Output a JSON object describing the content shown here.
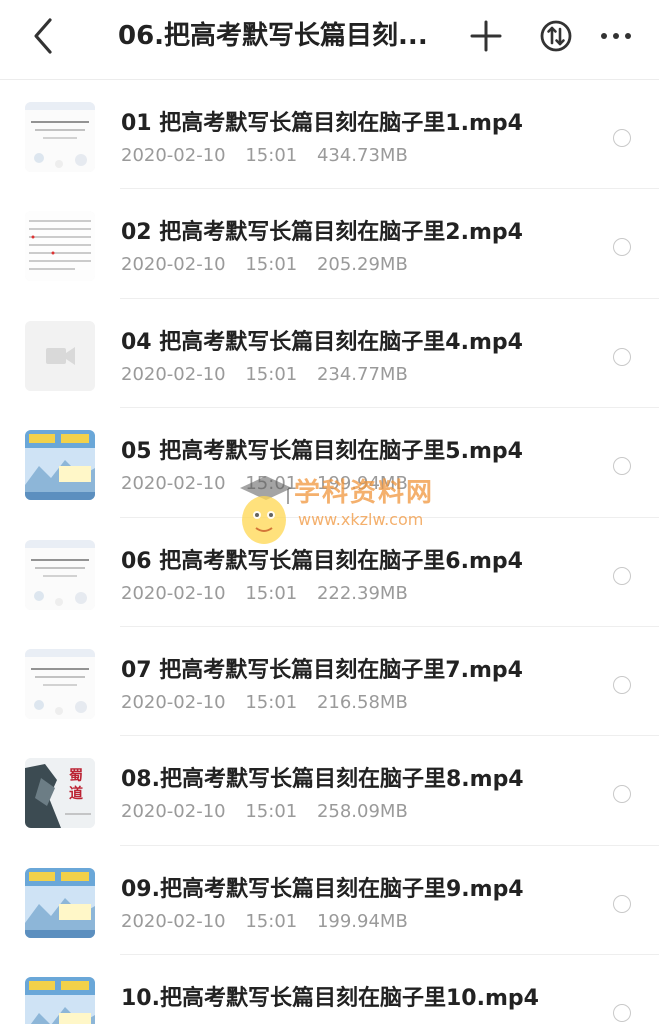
{
  "header": {
    "title": "06.把高考默写长篇目刻...",
    "back_icon": "chevron-left-icon",
    "add_icon": "plus-icon",
    "sort_icon": "sort-icon",
    "more_icon": "more-icon"
  },
  "files": [
    {
      "name": "01 把高考默写长篇目刻在脑子里1.mp4",
      "date": "2020-02-10",
      "time": "15:01",
      "size": "434.73MB",
      "thumb": "doc-white"
    },
    {
      "name": "02 把高考默写长篇目刻在脑子里2.mp4",
      "date": "2020-02-10",
      "time": "15:01",
      "size": "205.29MB",
      "thumb": "doc-text"
    },
    {
      "name": "04 把高考默写长篇目刻在脑子里4.mp4",
      "date": "2020-02-10",
      "time": "15:01",
      "size": "234.77MB",
      "thumb": "video-placeholder"
    },
    {
      "name": "05 把高考默写长篇目刻在脑子里5.mp4",
      "date": "2020-02-10",
      "time": "15:01",
      "size": "199.94MB",
      "thumb": "landscape-blue"
    },
    {
      "name": "06 把高考默写长篇目刻在脑子里6.mp4",
      "date": "2020-02-10",
      "time": "15:01",
      "size": "222.39MB",
      "thumb": "doc-white"
    },
    {
      "name": "07 把高考默写长篇目刻在脑子里7.mp4",
      "date": "2020-02-10",
      "time": "15:01",
      "size": "216.58MB",
      "thumb": "doc-white"
    },
    {
      "name": "08.把高考默写长篇目刻在脑子里8.mp4",
      "date": "2020-02-10",
      "time": "15:01",
      "size": "258.09MB",
      "thumb": "mountain-dark"
    },
    {
      "name": "09.把高考默写长篇目刻在脑子里9.mp4",
      "date": "2020-02-10",
      "time": "15:01",
      "size": "199.94MB",
      "thumb": "landscape-blue"
    },
    {
      "name": "10.把高考默写长篇目刻在脑子里10.mp4",
      "date": "",
      "time": "",
      "size": "",
      "thumb": "landscape-blue"
    }
  ],
  "watermark": {
    "text": "学科资料网",
    "url": "www.xkzlw.com"
  },
  "colors": {
    "title": "#222222",
    "meta": "#9a9a9a",
    "divider": "#eeeeee",
    "watermark": "#f0963c"
  }
}
